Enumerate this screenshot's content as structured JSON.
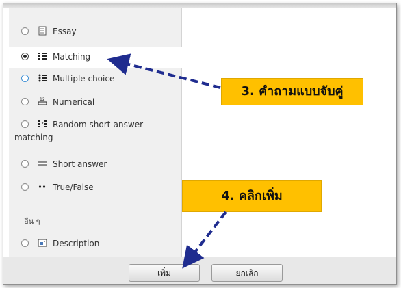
{
  "question_types": [
    {
      "label": "Essay",
      "icon": "essay-icon",
      "selected": false
    },
    {
      "label": "Matching",
      "icon": "matching-icon",
      "selected": true
    },
    {
      "label": "Multiple choice",
      "icon": "multiple-choice-icon",
      "selected": false
    },
    {
      "label": "Numerical",
      "icon": "numerical-icon",
      "selected": false
    },
    {
      "label": "Random short-answer",
      "label_line2": "matching",
      "icon": "random-short-answer-icon",
      "selected": false
    },
    {
      "label": "Short answer",
      "icon": "short-answer-icon",
      "selected": false
    },
    {
      "label": "True/False",
      "icon": "true-false-icon",
      "selected": false
    }
  ],
  "other_group": {
    "label": "อื่น ๆ",
    "items": [
      {
        "label": "Description",
        "icon": "description-icon",
        "selected": false
      }
    ]
  },
  "buttons": {
    "add_label": "เพิ่ม",
    "cancel_label": "ยกเลิก"
  },
  "annotations": {
    "step3": "3. คำถามแบบจับคู่",
    "step4": "4. คลิกเพิ่ม"
  },
  "colors": {
    "callout": "#ffc000",
    "arrow": "#1f2c8f"
  }
}
